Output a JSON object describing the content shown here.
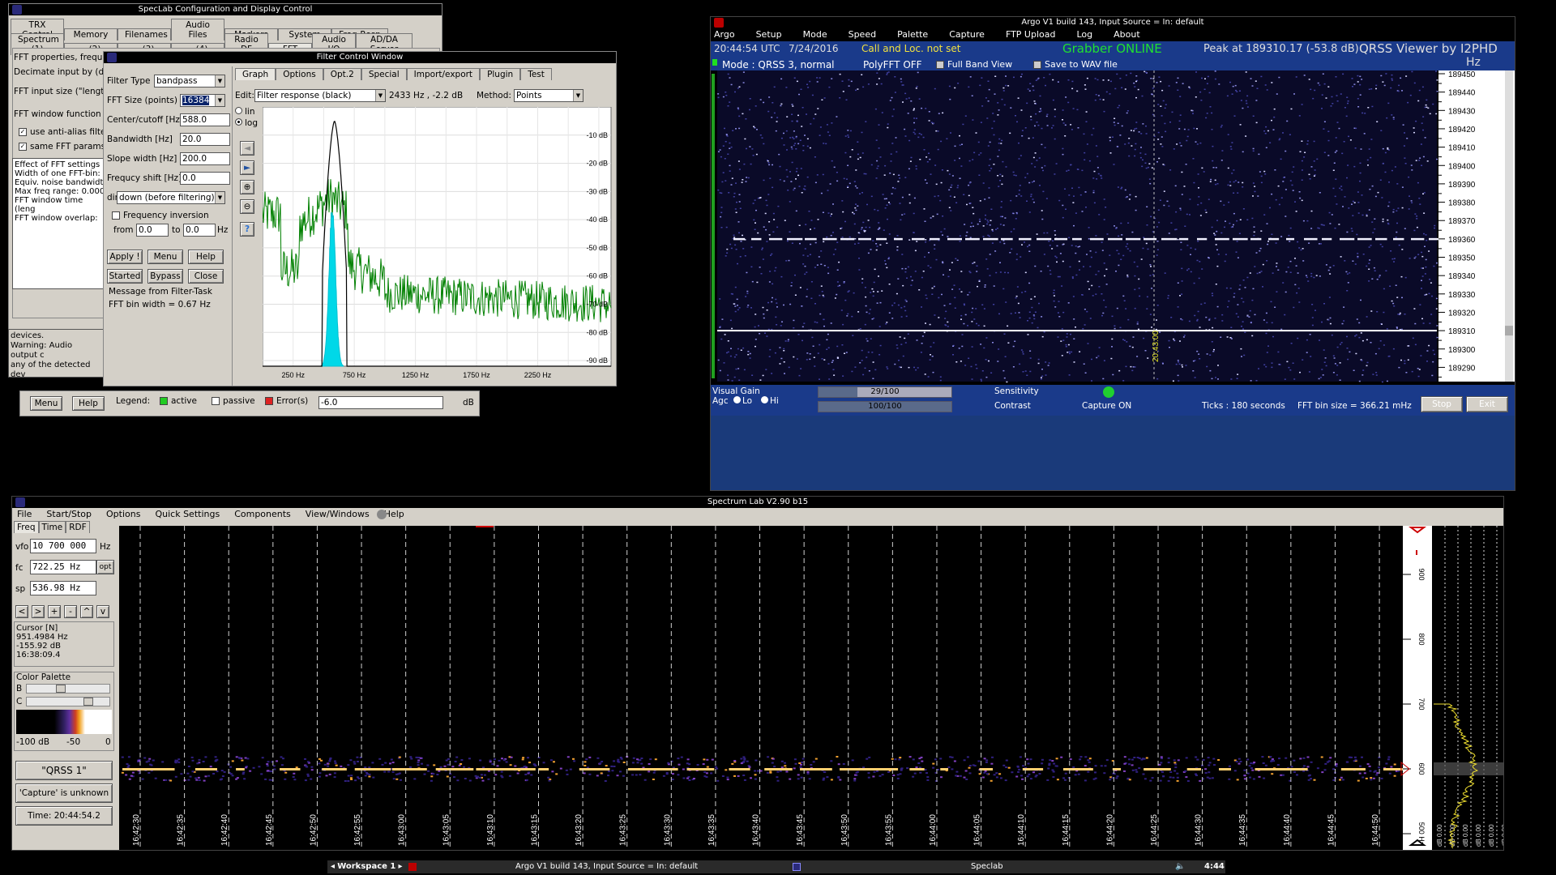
{
  "speclab_config": {
    "title": "SpecLab   Configuration and Display Control",
    "tabs_row1": [
      "TRX Control",
      "Memory",
      "Filenames",
      "Audio Files",
      "Markers",
      "System",
      "Freq-Resp"
    ],
    "tabs_row2": [
      "Spectrum (1)",
      ".. (2)",
      ".. (3)",
      ".. (4)",
      "Radio DF",
      "FFT",
      "Audio I/O",
      "AD/DA Server"
    ],
    "left_lines": [
      "FFT properties, freque",
      "Decimate input by (divi",
      "FFT input size (\"length",
      "FFT window function"
    ],
    "check_antialias": "use anti-alias filte",
    "check_same_fft": "same FFT params",
    "effect_lines": [
      "Effect of FFT settings",
      "Width of one FFT-bin:",
      "Equiv. noise bandwidt",
      "Max freq range: 0.000",
      "FFT window time (leng",
      "FFT window overlap:"
    ],
    "warning_lines": [
      "devices.",
      "Warning: Audio output c",
      "any of the detected dev"
    ],
    "menu_btn": "Menu",
    "help_btn": "Help",
    "legend_label": "Legend:",
    "legend_active": "active",
    "legend_passive": "passive",
    "legend_error": "Error(s)",
    "db_value": "-6.0",
    "db_unit": "dB"
  },
  "filter_window": {
    "title": "Filter Control Window",
    "filter_type_label": "Filter Type",
    "filter_type": "bandpass",
    "fft_size_label": "FFT Size (points)",
    "fft_size": "16384",
    "center_label": "Center/cutoff [Hz]",
    "center": "588.0",
    "bandwidth_label": "Bandwidth [Hz]",
    "bandwidth": "20.0",
    "slope_label": "Slope width [Hz]",
    "slope": "200.0",
    "shift_label": "Frequcy shift [Hz]",
    "shift": "0.0",
    "dir_label": "dir",
    "dir_value": "down (before filtering)",
    "freq_inversion": "Frequency inversion",
    "from_label": "from",
    "from_value": "0.0",
    "to_label": "to",
    "to_value": "0.0",
    "hz_label": "Hz",
    "btn_apply": "Apply !",
    "btn_menu": "Menu",
    "btn_help": "Help",
    "btn_started": "Started",
    "btn_bypass": "Bypass",
    "btn_close": "Close",
    "msg_label": "Message from Filter-Task",
    "fft_bin": "FFT bin width = 0.67 Hz",
    "tabs": [
      "Graph",
      "Options",
      "Opt.2",
      "Special",
      "Import/export",
      "Plugin",
      "Test"
    ],
    "edit_label": "Edit:",
    "edit_value": "Filter response (black)",
    "readout": "2433  Hz , -2.2 dB",
    "method_label": "Method:",
    "method_value": "Points",
    "lin_label": "lin",
    "log_label": "log",
    "db_ticks": [
      "-10 dB",
      "-20 dB",
      "-30 dB",
      "-40 dB",
      "-50 dB",
      "-60 dB",
      "-70 dB",
      "-80 dB",
      "-90 dB"
    ],
    "freq_ticks": [
      "250 Hz",
      "750 Hz",
      "1250 Hz",
      "1750 Hz",
      "2250 Hz"
    ]
  },
  "argo": {
    "title": "Argo V1 build 143, Input Source = In: default",
    "menu": [
      "Argo",
      "Setup",
      "Mode",
      "Speed",
      "Palette",
      "Capture",
      "FTP Upload",
      "Log",
      "About"
    ],
    "time": "20:44:54 UTC",
    "date": "7/24/2016",
    "call_loc": "Call and Loc. not set",
    "grabber": "Grabber ONLINE",
    "peak": "Peak at  189310.17 (-53.8 dB)",
    "viewer": "QRSS Viewer by I2PHD",
    "hz": "Hz",
    "mode": "Mode : QRSS 3, normal",
    "polyfft": "PolyFFT OFF",
    "full_band": "Full Band View",
    "save_wav": "Save to WAV file",
    "freq_ticks": [
      "189450",
      "189440",
      "189430",
      "189420",
      "189410",
      "189400",
      "189390",
      "189380",
      "189370",
      "189360",
      "189350",
      "189340",
      "189330",
      "189320",
      "189310",
      "189300",
      "189290"
    ],
    "time_marker": "20:43:00",
    "visual_gain": "Visual Gain",
    "agc": "Agc",
    "lo": "Lo",
    "hi": "Hi",
    "sens_value": "29/100",
    "contrast_value": "100/100",
    "sensitivity": "Sensitivity",
    "contrast": "Contrast",
    "capture_on": "Capture ON",
    "ticks": "Ticks   : 180 seconds",
    "fft_bin": "FFT bin size = 366.21 mHz",
    "stop": "Stop",
    "exit": "Exit"
  },
  "spectrum_lab": {
    "title": "Spectrum Lab V2.90 b15",
    "menu": [
      "File",
      "Start/Stop",
      "Options",
      "Quick Settings",
      "Components",
      "View/Windows",
      "Help"
    ],
    "side_tabs": [
      "Freq",
      "Time",
      "RDF"
    ],
    "vfo_label": "vfo",
    "vfo_value": "10 700 000",
    "vfo_unit": "Hz",
    "fc_label": "fc",
    "fc_value": "722.25 Hz",
    "fc_btn": "opt",
    "sp_label": "sp",
    "sp_value": "536.98 Hz",
    "nav_btns": [
      "<",
      ">",
      "+",
      "-",
      "^",
      "v"
    ],
    "cursor_title": "Cursor [N]",
    "cursor_lines": [
      "951.4984 Hz",
      "-155.92 dB",
      "16:38:09.4"
    ],
    "palette_title": "Color Palette",
    "pal_b": "B",
    "pal_c": "C",
    "pal_scale": [
      "-100 dB",
      "-50",
      "0"
    ],
    "mode_btn": "\"QRSS 1\"",
    "capture_btn": "'Capture' is unknown",
    "time_btn": "Time: 20:44:54.2",
    "time_ticks": [
      "16:42:30",
      "16:42:35",
      "16:42:40",
      "16:42:45",
      "16:42:50",
      "16:42:55",
      "16:43:00",
      "16:43:05",
      "16:43:10",
      "16:43:15",
      "16:43:20",
      "16:43:25",
      "16:43:30",
      "16:43:35",
      "16:43:40",
      "16:43:45",
      "16:43:50",
      "16:43:55",
      "16:44:00",
      "16:44:05",
      "16:44:10",
      "16:44:15",
      "16:44:20",
      "16:44:25",
      "16:44:30",
      "16:44:35",
      "16:44:40",
      "16:44:45",
      "16:44:50"
    ],
    "freq_axis": [
      "900",
      "800",
      "700",
      "600",
      "500 Hz"
    ],
    "mini_labels": [
      "dB 0.00",
      "dB 0.00",
      "dB 0.00",
      "dB 0.00",
      "dB 0.00",
      "dB 0.00"
    ]
  },
  "taskbar": {
    "workspace": "Workspace 1",
    "item1": "Argo V1 build 143, Input Source = In: default",
    "item2": "Speclab",
    "clock": "4:44"
  }
}
